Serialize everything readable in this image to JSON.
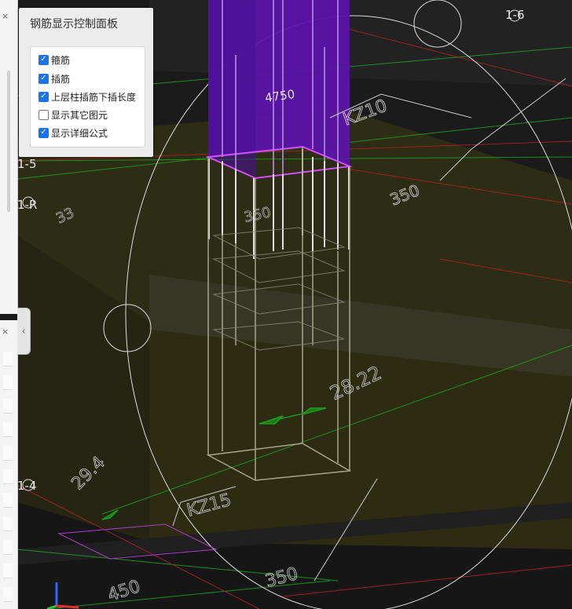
{
  "control_panel": {
    "title": "钢筋显示控制面板",
    "options": [
      {
        "label": "箍筋",
        "checked": true
      },
      {
        "label": "插筋",
        "checked": true
      },
      {
        "label": "上层柱插筋下插长度",
        "checked": true
      },
      {
        "label": "显示其它图元",
        "checked": false
      },
      {
        "label": "显示详细公式",
        "checked": true
      }
    ]
  },
  "axis_labels": {
    "a": "1-6",
    "b": "1-5",
    "c": "1-R",
    "d": "1-4"
  },
  "dimensions": {
    "length": "4750",
    "width_right": "350",
    "width_lower": "350",
    "width_bottom_left": "450",
    "width_bottom_right": "350",
    "diameter": "28.22",
    "angle": "29.4",
    "partial": "33"
  },
  "element_labels": {
    "upper_column": "KZ10",
    "lower_column": "KZ15"
  },
  "colors": {
    "column": "#5a14a8",
    "column_edge": "#d44cff",
    "slab": "#2f2e14",
    "rebar": "#d9d9d9",
    "axis_green": "#1f9a1f",
    "axis_red": "#a52222",
    "panel_bg": "#ececec",
    "checkbox": "#1a73e8"
  },
  "icons": {
    "strip_close": "×",
    "collapse": "‹"
  }
}
